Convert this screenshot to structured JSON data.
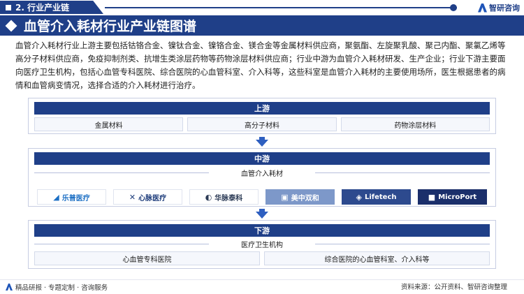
{
  "header": {
    "section": "2. 行业产业链",
    "brand": "智研咨询"
  },
  "title": "血管介入耗材行业产业链图谱",
  "intro": "血管介入耗材行业上游主要包括钴铬合金、镍钛合金、镍铬合金、镁合金等金属材料供应商，聚氨酯、左旋聚乳酸、聚己内酯、聚氯乙烯等高分子材料供应商，免疫抑制剂类、抗增生类涂层药物等药物涂层材料供应商；行业中游为血管介入耗材研发、生产企业；行业下游主要面向医疗卫生机构，包括心血管专科医院、综合医院的心血管科室、介入科等，这些科室是血管介入耗材的主要使用场所，医生根据患者的病情和血管病变情况，选择合适的介入耗材进行治疗。",
  "upstream": {
    "header": "上游",
    "items": [
      "金属材料",
      "高分子材料",
      "药物涂层材料"
    ]
  },
  "midstream": {
    "header": "中游",
    "sublabel": "血管介入耗材",
    "logos": [
      {
        "glyph": "◢",
        "text": "乐普医疗",
        "color": "#1c6fc4"
      },
      {
        "glyph": "✕",
        "text": "心脉医疗",
        "color": "#1e3d7b"
      },
      {
        "glyph": "◐",
        "text": "华脉泰科",
        "color": "#2b3a55"
      },
      {
        "glyph": "▣",
        "text": "美中双和",
        "color": "#ffffff"
      },
      {
        "glyph": "◈",
        "text": "Lifetech",
        "color": "#ffffff"
      },
      {
        "glyph": "■",
        "text": "MicroPort",
        "color": "#ffffff"
      }
    ]
  },
  "downstream": {
    "header": "下游",
    "sublabel": "医疗卫生机构",
    "items": [
      "心血管专科医院",
      "综合医院的心血管科室、介入科等"
    ]
  },
  "footer": {
    "left": "精品研报 · 专题定制 · 咨询服务",
    "right": "资料来源：公开资料、智研咨询整理"
  }
}
